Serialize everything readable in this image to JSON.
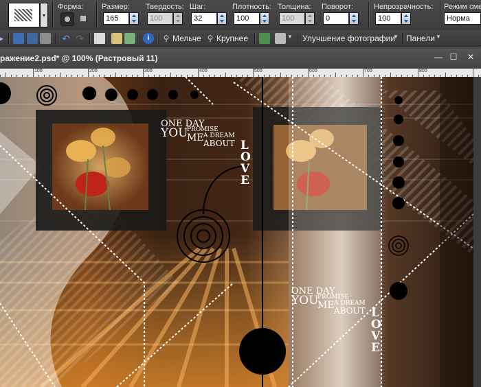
{
  "options_bar": {
    "shape_label": "Форма:",
    "size_label": "Размер:",
    "size_value": "165",
    "hardness_label": "Твердость:",
    "hardness_value": "100",
    "step_label": "Шаг:",
    "step_value": "32",
    "density_label": "Плотность:",
    "density_value": "100",
    "thickness_label": "Толщина:",
    "thickness_value": "100",
    "rotation_label": "Поворот:",
    "rotation_value": "0",
    "opacity_label": "Непрозрачность:",
    "opacity_value": "100",
    "blend_label": "Режим сме",
    "blend_value": "Норма"
  },
  "toolbar": {
    "zoom_out_label": "Мельче",
    "zoom_in_label": "Крупнее",
    "enhance_label": "Улучшение фотографии",
    "panels_label": "Панели"
  },
  "document": {
    "title": "ражение2.psd* @ 100% (Растровый 11)",
    "minimize_glyph": "—",
    "maximize_glyph": "☐",
    "close_glyph": "✕"
  },
  "ruler": {
    "labels": [
      "100",
      "200",
      "300",
      "400",
      "500",
      "600",
      "700",
      "800"
    ]
  },
  "artwork": {
    "text_block_1": {
      "line1": "ONE DAY",
      "line2a": "YOU",
      "line2b": "PROMISE",
      "line3a": "ME",
      "line3b": "A DREAM",
      "line4": "ABOUT",
      "love": "LOVE"
    },
    "text_block_2": {
      "line1": "ONE DAY",
      "line2a": "YOU",
      "line2b": "PROMISE",
      "line3a": "ME",
      "line3b": "A DREAM",
      "line4": "ABOUT",
      "love": "LOVE"
    }
  },
  "colors": {
    "canvas_accent": "#e08a2a",
    "poppy_red": "#c02418",
    "poppy_yellow": "#e8b050"
  }
}
